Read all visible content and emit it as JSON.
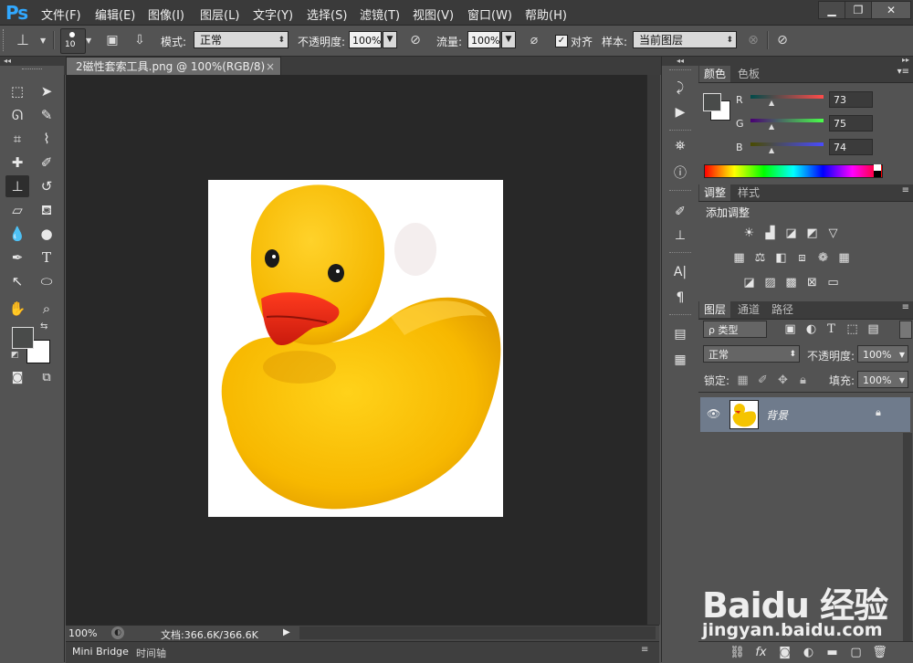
{
  "app": {
    "logo": "Ps"
  },
  "menu": [
    "文件(F)",
    "编辑(E)",
    "图像(I)",
    "图层(L)",
    "文字(Y)",
    "选择(S)",
    "滤镜(T)",
    "视图(V)",
    "窗口(W)",
    "帮助(H)"
  ],
  "window_buttons": {
    "minimize": "▁",
    "restore": "❐",
    "close": "✕"
  },
  "options": {
    "brush_size": "10",
    "mode_label": "模式:",
    "mode_value": "正常",
    "opacity_label": "不透明度:",
    "opacity_value": "100%",
    "flow_label": "流量:",
    "flow_value": "100%",
    "align_label": "对齐",
    "sample_label": "样本:",
    "sample_value": "当前图层"
  },
  "document": {
    "tab_title": "2磁性套索工具.png @ 100%(RGB/8)",
    "tab_close": "×"
  },
  "status": {
    "zoom": "100%",
    "doc_info": "文档:366.6K/366.6K"
  },
  "bottom_tabs": [
    "Mini Bridge",
    "时间轴"
  ],
  "color_panel": {
    "tabs": [
      "颜色",
      "色板"
    ],
    "r_label": "R",
    "g_label": "G",
    "b_label": "B",
    "r_value": "73",
    "g_value": "75",
    "b_value": "74",
    "foreground": "#494b4a",
    "background": "#ffffff"
  },
  "adjust_panel": {
    "tabs": [
      "调整",
      "样式"
    ],
    "title": "添加调整"
  },
  "layers_panel": {
    "tabs": [
      "图层",
      "通道",
      "路径"
    ],
    "filter_kind": "ρ 类型",
    "blend_mode": "正常",
    "opacity_label": "不透明度:",
    "opacity_value": "100%",
    "lock_label": "锁定:",
    "fill_label": "填充:",
    "fill_value": "100%",
    "layer_name": "背景"
  },
  "watermark": {
    "brand": "Baidu 经验",
    "url": "jingyan.baidu.com"
  },
  "colors": {
    "app_bg": "#535353",
    "canvas_bg": "#282828",
    "menubar": "#3a3a3a",
    "selected_layer": "#6f7b8c",
    "duck_yellow": "#f5c400",
    "beak_red": "#e02a12"
  }
}
